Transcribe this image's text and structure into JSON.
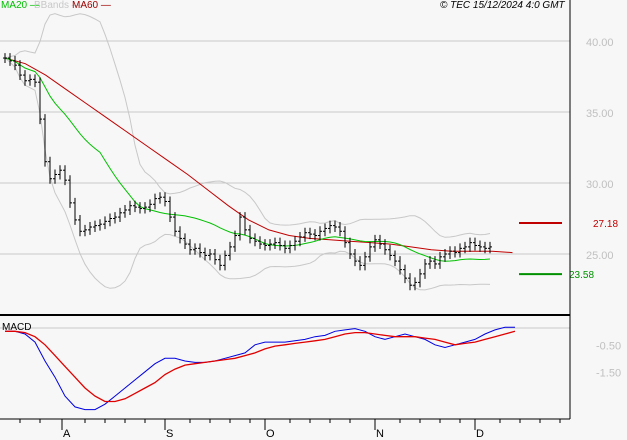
{
  "legend": {
    "ma20": "MA20",
    "bbands": "BBands",
    "ma60": "MA60"
  },
  "copyright": "© TEC 15/12/2024 4:0 GMT",
  "macd_label": "MACD",
  "colors": {
    "ma20": "#00c000",
    "ma60": "#c00000",
    "bbands": "#c8c8c8",
    "macd": "#0000e0",
    "signal": "#e00000",
    "price": "#000000"
  },
  "chart_data": {
    "type": "line",
    "title": "",
    "price_axis": {
      "ticks": [
        40,
        35,
        30,
        25
      ],
      "tick_labels": [
        "40.00",
        "35.00",
        "30.00",
        "25.00"
      ],
      "ylim": [
        21,
        42.5
      ]
    },
    "levels": [
      {
        "label": "27.18",
        "value": 27.18,
        "color": "#c00000"
      },
      {
        "label": "23.58",
        "value": 23.58,
        "color": "#009000"
      }
    ],
    "x_labels": [
      "A",
      "S",
      "O",
      "N",
      "D"
    ],
    "closes": [
      38.8,
      38.6,
      38.3,
      37.6,
      37.2,
      37.3,
      37.1,
      34.5,
      31.5,
      30.3,
      30.6,
      30.9,
      30.2,
      28.6,
      27.4,
      26.6,
      26.7,
      26.9,
      27.0,
      27.1,
      27.3,
      27.5,
      27.6,
      27.9,
      28.1,
      28.4,
      28.3,
      28.2,
      28.3,
      28.5,
      28.9,
      29.0,
      28.7,
      27.6,
      26.6,
      26.1,
      25.7,
      25.3,
      25.4,
      25.1,
      24.9,
      25.0,
      24.6,
      24.2,
      24.9,
      25.5,
      26.3,
      27.6,
      26.7,
      26.1,
      25.9,
      25.7,
      25.6,
      25.7,
      25.8,
      25.6,
      25.4,
      25.6,
      25.9,
      26.2,
      26.5,
      26.4,
      26.3,
      26.6,
      26.8,
      27.0,
      26.9,
      26.6,
      25.8,
      25.0,
      24.5,
      24.2,
      24.8,
      25.5,
      26.0,
      25.7,
      25.3,
      24.9,
      24.5,
      23.9,
      23.3,
      22.8,
      23.0,
      23.6,
      24.3,
      24.5,
      24.3,
      24.8,
      25.0,
      25.2,
      25.1,
      25.4,
      25.5,
      25.8,
      25.6,
      25.5,
      25.4,
      25.5
    ],
    "ma60": [
      38.8,
      38.4,
      37.6,
      36.6,
      35.6,
      34.6,
      33.6,
      32.6,
      31.6,
      30.6,
      29.5,
      28.4,
      27.4,
      26.7,
      26.3,
      26.1,
      26.0,
      25.9,
      25.8,
      25.7,
      25.5,
      25.3,
      25.2,
      25.2,
      25.2,
      25.1
    ],
    "macd": [
      0.1,
      0.1,
      0,
      -0.3,
      -1.0,
      -1.6,
      -2.3,
      -2.7,
      -2.8,
      -2.8,
      -2.6,
      -2.3,
      -2.0,
      -1.7,
      -1.4,
      -1.1,
      -0.9,
      -0.9,
      -1.0,
      -1.05,
      -1.05,
      -1.0,
      -0.9,
      -0.8,
      -0.7,
      -0.4,
      -0.3,
      -0.3,
      -0.3,
      -0.25,
      -0.2,
      -0.1,
      -0.05,
      0.1,
      0.15,
      0.2,
      0.1,
      -0.1,
      -0.2,
      -0.1,
      0,
      -0.1,
      -0.2,
      -0.4,
      -0.5,
      -0.4,
      -0.3,
      -0.2,
      0,
      0.15,
      0.25,
      0.25
    ],
    "signal": [
      0.1,
      0.1,
      0.05,
      -0.1,
      -0.4,
      -0.8,
      -1.2,
      -1.6,
      -2.0,
      -2.3,
      -2.5,
      -2.5,
      -2.4,
      -2.2,
      -2.0,
      -1.8,
      -1.5,
      -1.3,
      -1.15,
      -1.1,
      -1.05,
      -1.0,
      -0.95,
      -0.9,
      -0.8,
      -0.7,
      -0.55,
      -0.45,
      -0.4,
      -0.35,
      -0.3,
      -0.25,
      -0.2,
      -0.1,
      0,
      0.05,
      0.05,
      0,
      -0.05,
      -0.1,
      -0.1,
      -0.1,
      -0.15,
      -0.2,
      -0.3,
      -0.4,
      -0.35,
      -0.3,
      -0.2,
      -0.1,
      0,
      0.1
    ],
    "macd_axis": {
      "tick_labels": [
        "-0.50",
        "-1.50"
      ],
      "ticks": [
        -0.5,
        -1.5
      ]
    }
  }
}
